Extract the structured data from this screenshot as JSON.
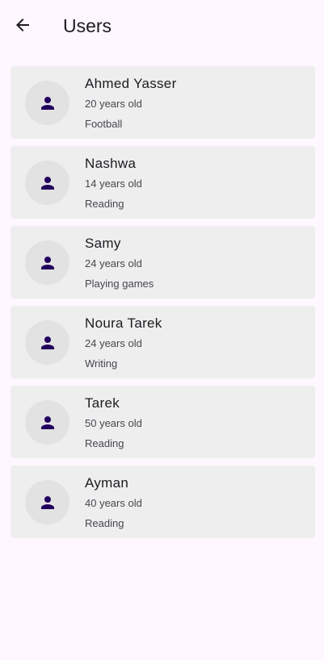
{
  "app_bar": {
    "title": "Users",
    "back_icon": "arrow-back-icon"
  },
  "users": [
    {
      "name": "Ahmed Yasser",
      "age": "20 years old",
      "hobby": "Football"
    },
    {
      "name": "Nashwa",
      "age": "14 years old",
      "hobby": "Reading"
    },
    {
      "name": "Samy",
      "age": "24 years old",
      "hobby": "Playing games"
    },
    {
      "name": "Noura Tarek",
      "age": "24 years old",
      "hobby": "Writing"
    },
    {
      "name": "Tarek",
      "age": "50 years old",
      "hobby": "Reading"
    },
    {
      "name": "Ayman",
      "age": "40 years old",
      "hobby": "Reading"
    }
  ],
  "avatar_icon": "person-icon",
  "colors": {
    "background": "#FEF7FF",
    "card": "#EEEEEE",
    "avatar_bg": "#E2E2E2",
    "avatar_icon": "#21005D",
    "text_primary": "#1D1B20",
    "text_secondary": "#49454F"
  }
}
